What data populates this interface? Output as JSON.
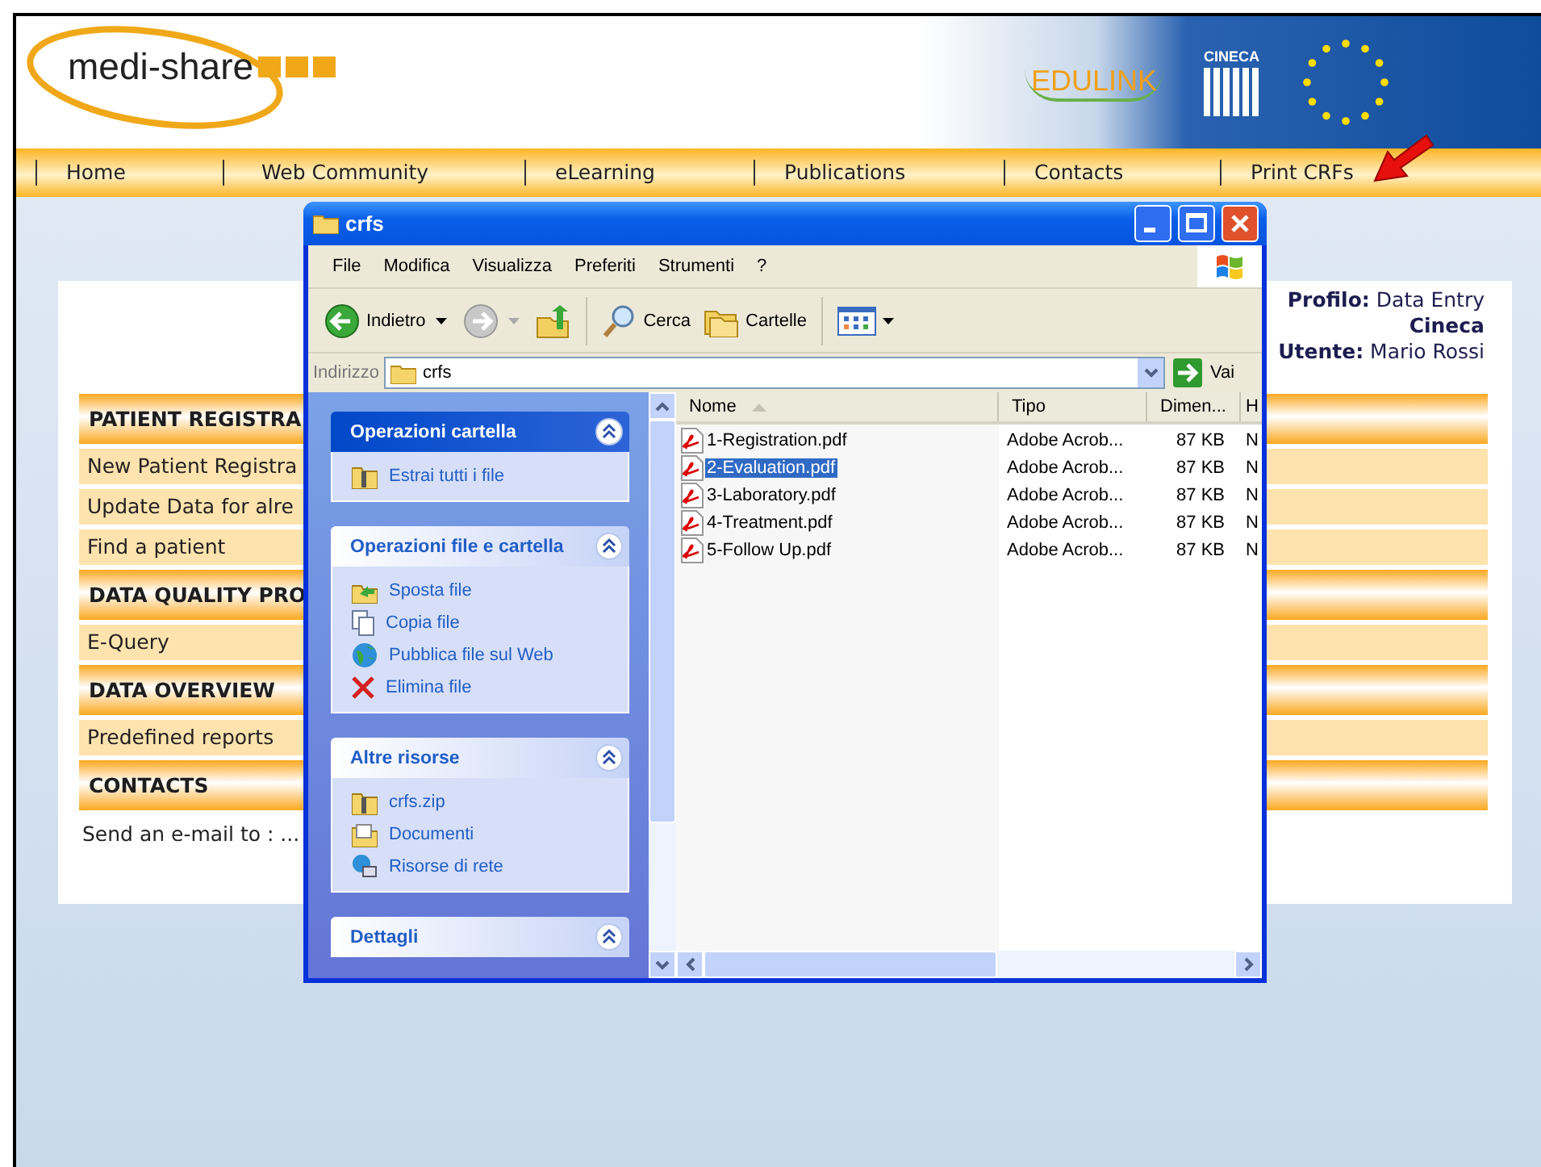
{
  "header": {
    "logo": "medi-share",
    "partner_logos": [
      "EDULINK",
      "CINECA"
    ]
  },
  "nav": [
    "Home",
    "Web Community",
    "eLearning",
    "Publications",
    "Contacts",
    "Print CRFs"
  ],
  "user_info": [
    "**Profilo:** Data Entry",
    "**Cineca**",
    "**Utente:** Mario Rossi"
  ],
  "menu": [
    {
      "kind": "header",
      "label": "PATIENT REGISTRA"
    },
    {
      "kind": "item",
      "label": "New Patient Registra"
    },
    {
      "kind": "item",
      "label": "Update Data for alre"
    },
    {
      "kind": "item",
      "label": "Find a patient"
    },
    {
      "kind": "header",
      "label": "DATA QUALITY PRO"
    },
    {
      "kind": "item",
      "label": "E-Query"
    },
    {
      "kind": "header",
      "label": "DATA OVERVIEW"
    },
    {
      "kind": "item",
      "label": "Predefined reports"
    },
    {
      "kind": "header",
      "label": "CONTACTS"
    },
    {
      "kind": "note",
      "label": "Send an e-mail to : ..."
    }
  ],
  "window": {
    "title": "crfs",
    "menu": [
      "File",
      "Modifica",
      "Visualizza",
      "Preferiti",
      "Strumenti",
      "?"
    ],
    "toolbar": {
      "back": "Indietro",
      "search": "Cerca",
      "folders": "Cartelle"
    },
    "address_label": "Indirizzo",
    "address": "crfs",
    "go": "Vai",
    "task_panes": [
      {
        "title": "Operazioni cartella",
        "items": [
          {
            "kind": "zip",
            "label": "Estrai tutti i file"
          }
        ]
      },
      {
        "title": "Operazioni file e cartella",
        "items": [
          {
            "kind": "move",
            "label": "Sposta file"
          },
          {
            "kind": "copy",
            "label": "Copia file"
          },
          {
            "kind": "web",
            "label": "Pubblica file sul Web"
          },
          {
            "kind": "delete",
            "label": "Elimina file"
          }
        ]
      },
      {
        "title": "Altre risorse",
        "items": [
          {
            "kind": "zip",
            "label": "crfs.zip"
          },
          {
            "kind": "docs",
            "label": "Documenti"
          },
          {
            "kind": "network",
            "label": "Risorse di rete"
          }
        ]
      },
      {
        "title": "Dettagli"
      }
    ],
    "columns": [
      "Nome",
      "Tipo",
      "Dimen...",
      "H"
    ],
    "files": [
      {
        "name": "1-Registration.pdf",
        "type": "Adobe Acrob...",
        "size": "87 KB",
        "column_4": "N",
        "selected": false
      },
      {
        "name": "2-Evaluation.pdf",
        "type": "Adobe Acrob...",
        "size": "87 KB",
        "column_4": "N",
        "selected": true
      },
      {
        "name": "3-Laboratory.pdf",
        "type": "Adobe Acrob...",
        "size": "87 KB",
        "column_4": "N",
        "selected": false
      },
      {
        "name": "4-Treatment.pdf",
        "type": "Adobe Acrob...",
        "size": "87 KB",
        "column_4": "N",
        "selected": false
      },
      {
        "name": "5-Follow Up.pdf",
        "type": "Adobe Acrob...",
        "size": "87 KB",
        "column_4": "N",
        "selected": false
      }
    ]
  }
}
